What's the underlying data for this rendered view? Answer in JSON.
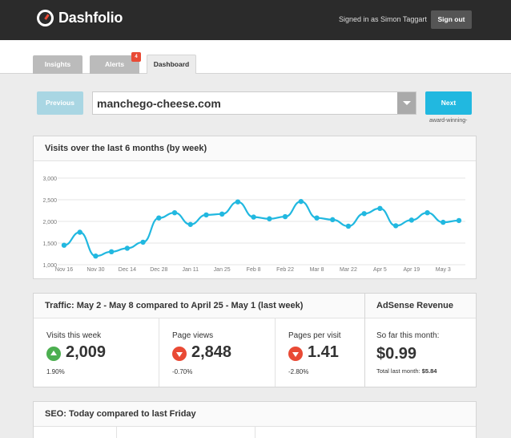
{
  "header": {
    "brand": "Dashfolio",
    "signed_in_text": "Signed in as Simon Taggart",
    "sign_out_label": "Sign out"
  },
  "tabs": [
    {
      "label": "Insights"
    },
    {
      "label": "Alerts",
      "badge": "4"
    },
    {
      "label": "Dashboard",
      "active": true
    }
  ],
  "domain_picker": {
    "previous_label": "Previous",
    "selected_domain": "manchego-cheese.com",
    "next_label": "Next",
    "next_hint": "award-winning-"
  },
  "visits_panel": {
    "title": "Visits over the last 6 months (by week)"
  },
  "chart_data": {
    "type": "line",
    "title": "Visits over the last 6 months (by week)",
    "ylim": [
      1000,
      3000
    ],
    "yticks": [
      "1,000",
      "1,500",
      "2,000",
      "2,500",
      "3,000"
    ],
    "ytick_values": [
      1000,
      1500,
      2000,
      2500,
      3000
    ],
    "xtick_labels": [
      "Nov 16",
      "Nov 30",
      "Dec 14",
      "Dec 28",
      "Jan 11",
      "Jan 25",
      "Feb 8",
      "Feb 22",
      "Mar 8",
      "Mar 22",
      "Apr 5",
      "Apr 19",
      "May 3"
    ],
    "color": "#21b8e0",
    "values": [
      1450,
      1750,
      1200,
      1300,
      1380,
      1520,
      2080,
      2200,
      1930,
      2150,
      2170,
      2450,
      2100,
      2060,
      2110,
      2460,
      2080,
      2040,
      1890,
      2180,
      2300,
      1900,
      2030,
      2200,
      1980,
      2020
    ]
  },
  "traffic_panel": {
    "title": "Traffic: May 2 - May 8 compared to April 25 - May 1 (last week)",
    "metrics": [
      {
        "label": "Visits this week",
        "value": "2,009",
        "change": "1.90%",
        "direction": "up"
      },
      {
        "label": "Page views",
        "value": "2,848",
        "change": "-0.70%",
        "direction": "down"
      },
      {
        "label": "Pages per visit",
        "value": "1.41",
        "change": "-2.80%",
        "direction": "down"
      }
    ]
  },
  "adsense_panel": {
    "title": "AdSense Revenue",
    "label": "So far this month:",
    "value": "$0.99",
    "last_month_label": "Total last month:",
    "last_month_value": "$5.84"
  },
  "seo_panel": {
    "title": "SEO: Today compared to last Friday"
  },
  "colors": {
    "topbar": "#2b2b2b",
    "accent": "#21b8e0",
    "up": "#4caf50",
    "down": "#e94a35"
  }
}
